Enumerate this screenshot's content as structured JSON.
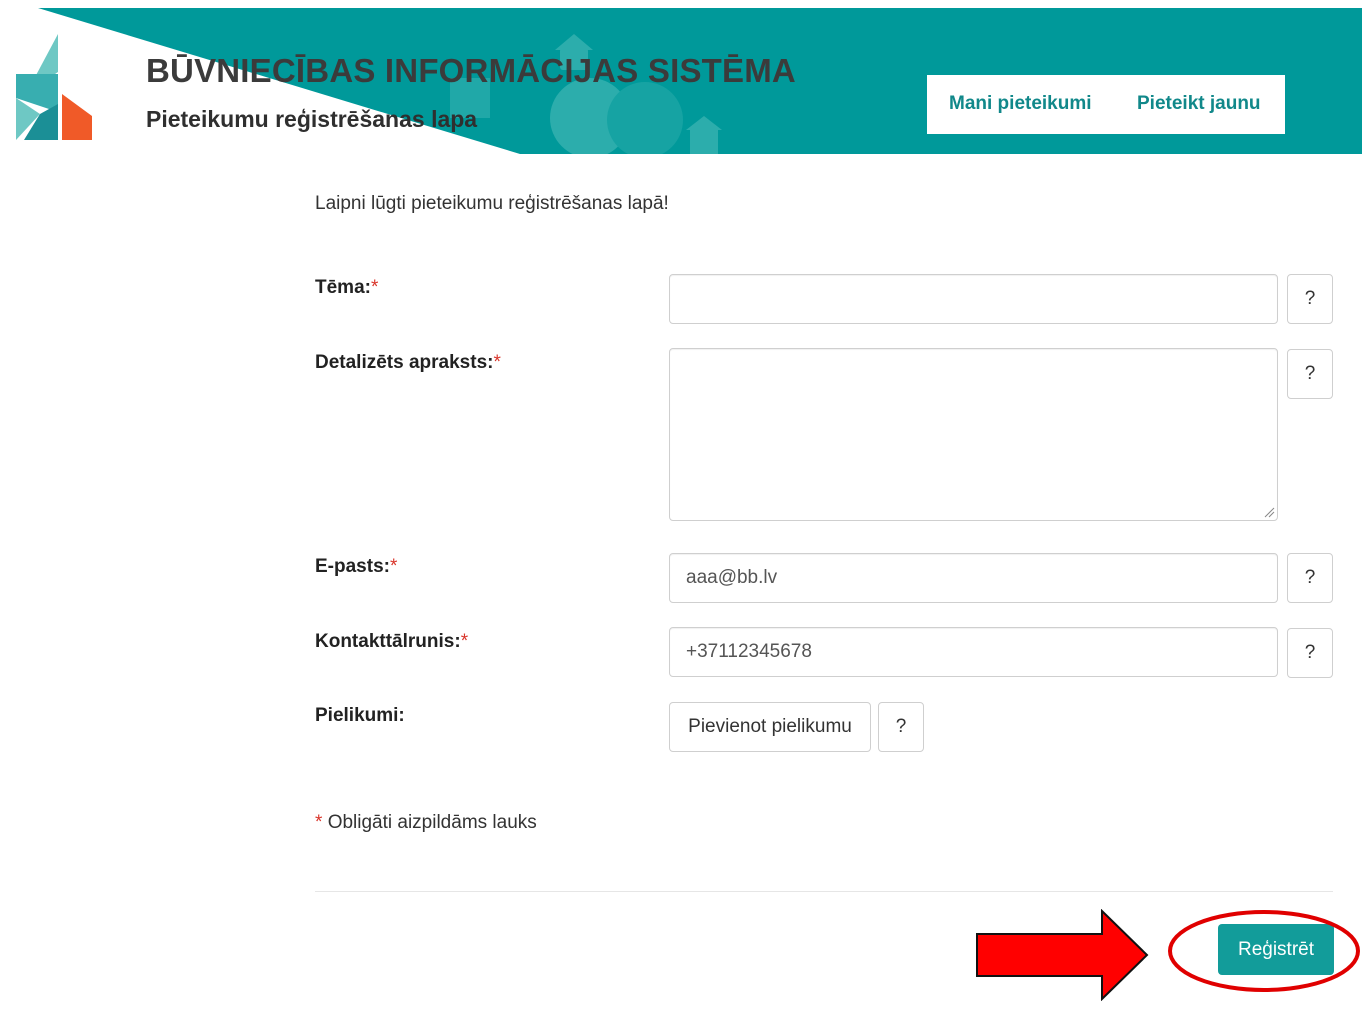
{
  "header": {
    "title": "BŪVNIECĪBAS INFORMĀCIJAS SISTĒMA",
    "subtitle": "Pieteikumu reģistrēšanas lapa",
    "brand_color": "#00999a",
    "nav": [
      {
        "label": "Mani pieteikumi"
      },
      {
        "label": "Pieteikt jaunu"
      }
    ]
  },
  "form": {
    "welcome": "Laipni lūgti pieteikumu reģistrēšanas lapā!",
    "required_mark": "*",
    "fields": {
      "tema": {
        "label": "Tēma:",
        "value": ""
      },
      "apraksts": {
        "label": "Detalizēts apraksts:",
        "value": ""
      },
      "epasts": {
        "label": "E-pasts:",
        "value": "aaa@bb.lv"
      },
      "talrunis": {
        "label": "Kontakttālrunis:",
        "value": "+37112345678"
      },
      "pielikumi": {
        "label": "Pielikumi:",
        "button_label": "Pievienot pielikumu"
      }
    },
    "help_label": "?",
    "required_note": "Obligāti aizpildāms lauks",
    "submit_label": "Reģistrēt"
  },
  "annotation": {
    "arrow_color": "#ff0000",
    "ellipse_color": "#e00000"
  }
}
